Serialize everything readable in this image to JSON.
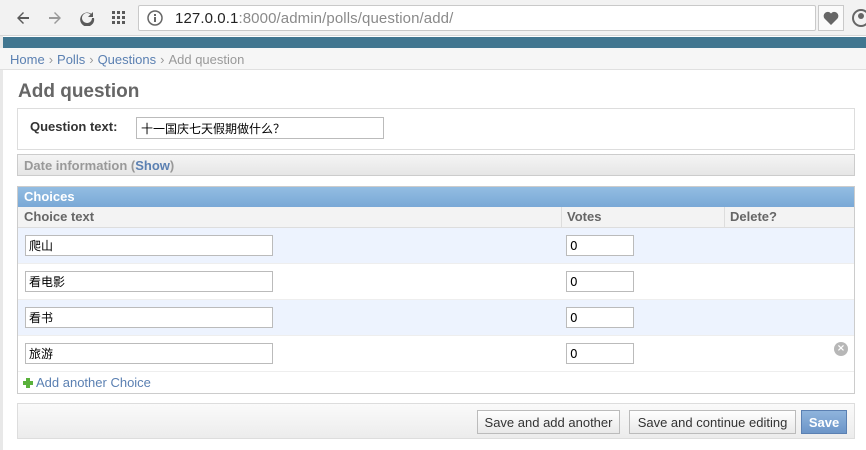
{
  "browser": {
    "url_host": "127.0.0.1",
    "url_rest": ":8000/admin/polls/question/add/"
  },
  "breadcrumbs": [
    {
      "label": "Home"
    },
    {
      "label": "Polls"
    },
    {
      "label": "Questions"
    },
    {
      "label": "Add question"
    }
  ],
  "page": {
    "title": "Add question"
  },
  "question": {
    "label": "Question text:",
    "value": "十一国庆七天假期做什么？"
  },
  "date_info": {
    "label": "Date information",
    "toggle": "Show"
  },
  "choices": {
    "heading": "Choices",
    "columns": [
      "Choice text",
      "Votes",
      "Delete?"
    ],
    "rows": [
      {
        "text": "爬山",
        "votes": "0"
      },
      {
        "text": "看电影",
        "votes": "0"
      },
      {
        "text": "看书",
        "votes": "0"
      },
      {
        "text": "旅游",
        "votes": "0"
      }
    ],
    "add_label": "Add another Choice"
  },
  "submit": {
    "save_add_another": "Save and add another",
    "save_continue": "Save and continue editing",
    "save": "Save"
  },
  "colors": {
    "header": "#417690",
    "link": "#5b80b2",
    "choices_header": "#79a8d6"
  }
}
